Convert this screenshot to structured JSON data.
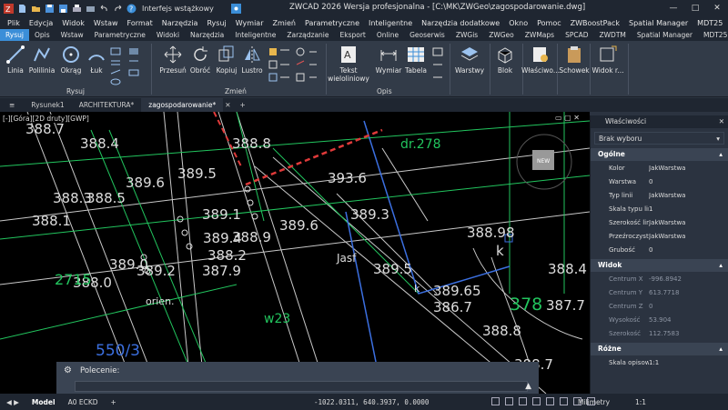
{
  "titlebar": {
    "workspace": "Interfejs wstążkowy",
    "title": "ZWCAD 2026 Wersja profesjonalna - [C:\\MK\\ZWGeo\\zagospodarowanie.dwg]"
  },
  "menu": [
    "Plik",
    "Edycja",
    "Widok",
    "Wstaw",
    "Format",
    "Narzędzia",
    "Rysuj",
    "Wymiar",
    "Zmień",
    "Parametryczne",
    "Inteligentne",
    "Narzędzia dodatkowe",
    "Okno",
    "Pomoc",
    "ZWBoostPack",
    "Spatial Manager",
    "MDT25"
  ],
  "ribbon_tabs": [
    "Rysuj",
    "Opis",
    "Wstaw",
    "Parametryczne",
    "Widoki",
    "Narzędzia",
    "Inteligentne",
    "Zarządzanie",
    "Eksport",
    "Online",
    "Geoserwis",
    "ZWGis",
    "ZWGeo",
    "ZWMaps",
    "SPCAD",
    "ZWDTM",
    "Spatial Manager",
    "MDT25"
  ],
  "ribbon": {
    "draw": {
      "linia": "Linia",
      "polilinia": "Polilinia",
      "okrag": "Okrąg",
      "luk": "Łuk",
      "group": "Rysuj"
    },
    "modify": {
      "przesun": "Przesuń",
      "obroc": "Obróć",
      "kopiuj": "Kopiuj",
      "lustro": "Lustro",
      "group": "Zmień"
    },
    "annot": {
      "tekst": "Tekst",
      "tekst2": "wieloliniowy",
      "wymiar": "Wymiar",
      "tabela": "Tabela",
      "group": "Opis"
    },
    "warstwy": "Warstwy",
    "blok": "Blok",
    "wlasciwosci": "Właściwo...",
    "schowek": "Schowek",
    "widok": "Widok r..."
  },
  "doc_tabs": [
    "Rysunek1",
    "ARCHITEKTURA*",
    "zagospodarowanie*"
  ],
  "viewport_label": "[-][Góra][2D druty][GWP]",
  "viewcube": "NEW",
  "drawing_labels": [
    "388.7",
    "388.4",
    "388.3",
    "388.5",
    "388.1",
    "389.6",
    "388.8",
    "389.5",
    "393.6",
    "389.1",
    "389.6",
    "388.2",
    "388.9",
    "389.3",
    "389.4",
    "387.9",
    "389.0",
    "389.2",
    "388.0",
    "389.5",
    "389.65",
    "386.7",
    "388.98",
    "378",
    "388.8",
    "388.4",
    "387.7",
    "388.7",
    "550/3",
    "2715",
    "k",
    "k",
    "dr.278",
    "w23",
    "Jasf",
    "orien."
  ],
  "properties": {
    "title": "Właściwości",
    "selection": "Brak wyboru",
    "general_title": "Ogólne",
    "general": [
      {
        "k": "Kolor",
        "v": "JakWarstwa"
      },
      {
        "k": "Warstwa",
        "v": "0"
      },
      {
        "k": "Typ linii",
        "v": "JakWarstwa"
      },
      {
        "k": "Skala typu linii",
        "v": "1"
      },
      {
        "k": "Szerokość linii",
        "v": "JakWarstwa"
      },
      {
        "k": "Przeźroczystość",
        "v": "JakWarstwa"
      },
      {
        "k": "Grubość",
        "v": "0"
      }
    ],
    "view_title": "Widok",
    "view": [
      {
        "k": "Centrum X",
        "v": "-996.8942"
      },
      {
        "k": "Centrum Y",
        "v": "613.7718"
      },
      {
        "k": "Centrum Z",
        "v": "0"
      },
      {
        "k": "Wysokość",
        "v": "53.904"
      },
      {
        "k": "Szerokość",
        "v": "112.7583"
      }
    ],
    "misc_title": "Różne",
    "misc": [
      {
        "k": "Skala opisowa",
        "v": "1:1"
      }
    ]
  },
  "command": {
    "label": "Polecenie:"
  },
  "status": {
    "tabs": [
      "Model",
      "A0 ECKD"
    ],
    "coords": "-1022.0311, 640.3937, 0.0000",
    "units": "Milimetry",
    "scale": "1:1"
  },
  "colors": {
    "accent": "#3b8ed8",
    "canvas": "#000000",
    "panel": "#2b3340"
  }
}
